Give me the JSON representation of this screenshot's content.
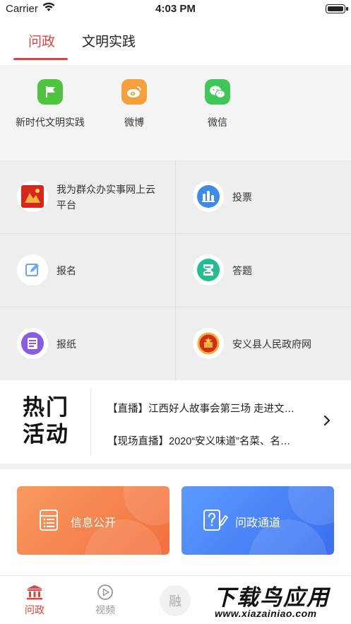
{
  "status_bar": {
    "carrier": "Carrier",
    "time": "4:03 PM"
  },
  "top_tabs": [
    {
      "label": "问政",
      "active": true
    },
    {
      "label": "文明实践",
      "active": false
    }
  ],
  "quick_links": [
    {
      "label": "新时代文明实践",
      "icon": "flag-icon",
      "color": "#4fc53f"
    },
    {
      "label": "微博",
      "icon": "weibo-icon",
      "color": "#f5a03a"
    },
    {
      "label": "微信",
      "icon": "wechat-icon",
      "color": "#3fc85a"
    }
  ],
  "services": [
    {
      "label": "我为群众办实事网上云平台",
      "icon": "cloud-platform-icon"
    },
    {
      "label": "投票",
      "icon": "vote-icon"
    },
    {
      "label": "报名",
      "icon": "signup-icon"
    },
    {
      "label": "答题",
      "icon": "quiz-icon"
    },
    {
      "label": "报纸",
      "icon": "newspaper-icon"
    },
    {
      "label": "安义县人民政府网",
      "icon": "gov-emblem-icon"
    }
  ],
  "hot_activities": {
    "title_line1": "热门",
    "title_line2": "活动",
    "items": [
      "【直播】江西好人故事会第三场 走进文…",
      "【现场直播】2020“安义味道”名菜、名…"
    ]
  },
  "cards": [
    {
      "label": "信息公开",
      "icon": "info-list-icon",
      "color": "#f5834c"
    },
    {
      "label": "问政通道",
      "icon": "question-pen-icon",
      "color": "#4a84f7"
    }
  ],
  "tab_bar": [
    {
      "label": "问政",
      "icon": "government-building-icon",
      "active": true
    },
    {
      "label": "视频",
      "icon": "play-circle-icon",
      "active": false
    },
    {
      "label": "融",
      "icon": "rong-center-icon",
      "active": false
    }
  ],
  "watermark": {
    "main": "下载鸟应用",
    "sub": "www.xiazainiao.com"
  },
  "colors": {
    "accent": "#e5403a"
  }
}
